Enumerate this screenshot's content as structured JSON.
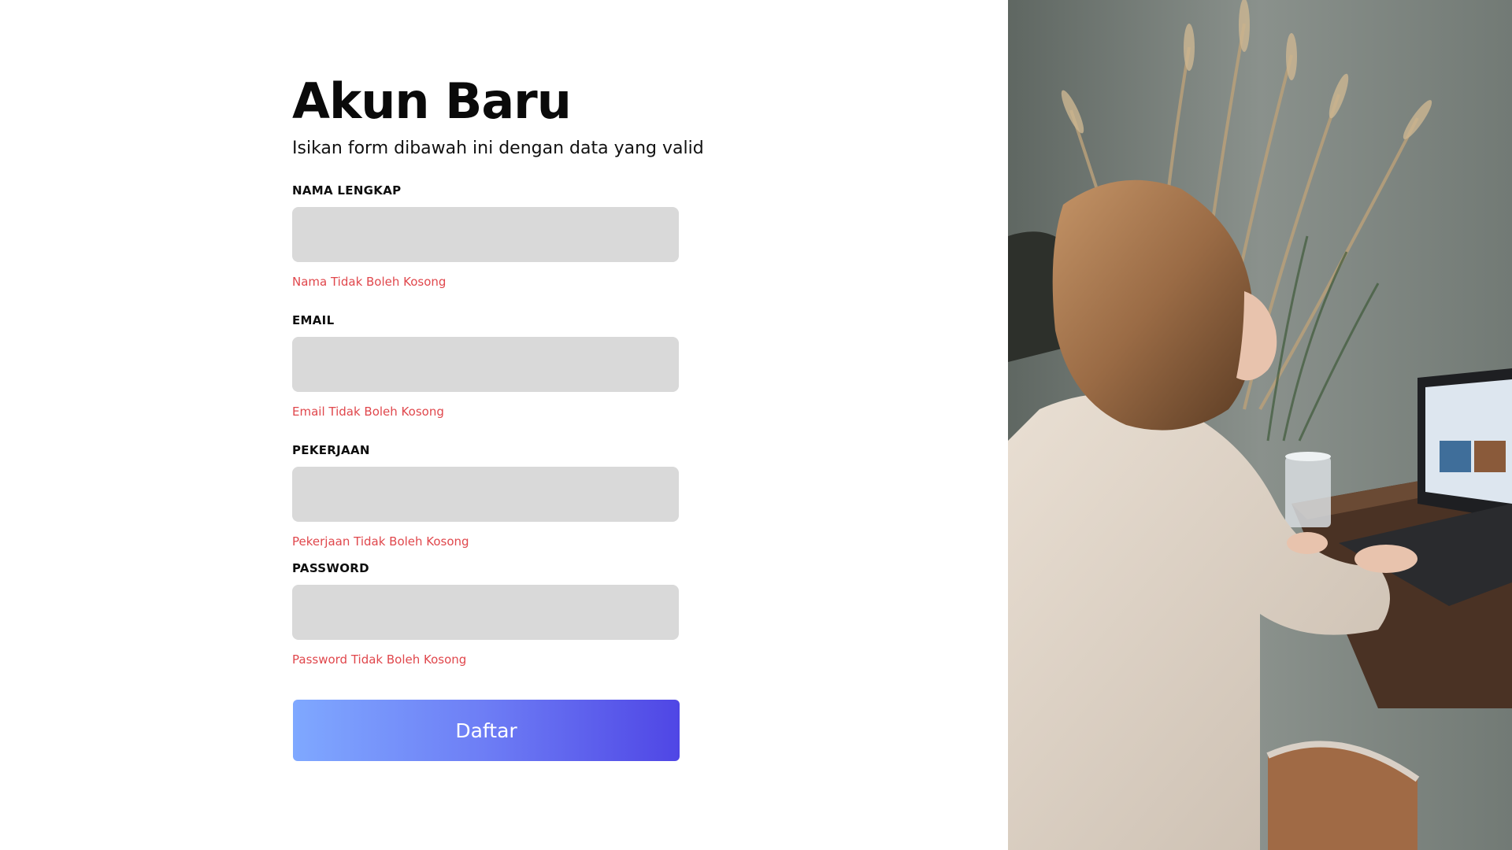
{
  "form": {
    "title": "Akun Baru",
    "subtitle": "Isikan form dibawah ini dengan data yang valid",
    "fields": [
      {
        "label": "NAMA LENGKAP",
        "value": "",
        "error": "Nama Tidak Boleh Kosong"
      },
      {
        "label": "EMAIL",
        "value": "",
        "error": "Email Tidak Boleh Kosong"
      },
      {
        "label": "PEKERJAAN",
        "value": "",
        "error": "Pekerjaan Tidak Boleh Kosong"
      },
      {
        "label": "PASSWORD",
        "value": "",
        "error": "Password Tidak Boleh Kosong"
      }
    ],
    "submit_label": "Daftar"
  },
  "colors": {
    "error": "#e0474c",
    "input_bg": "#d9d9d9",
    "button_gradient_start": "#7fa8ff",
    "button_gradient_end": "#4f46e5"
  },
  "photo": {
    "icon": "woman-at-laptop-photo"
  }
}
